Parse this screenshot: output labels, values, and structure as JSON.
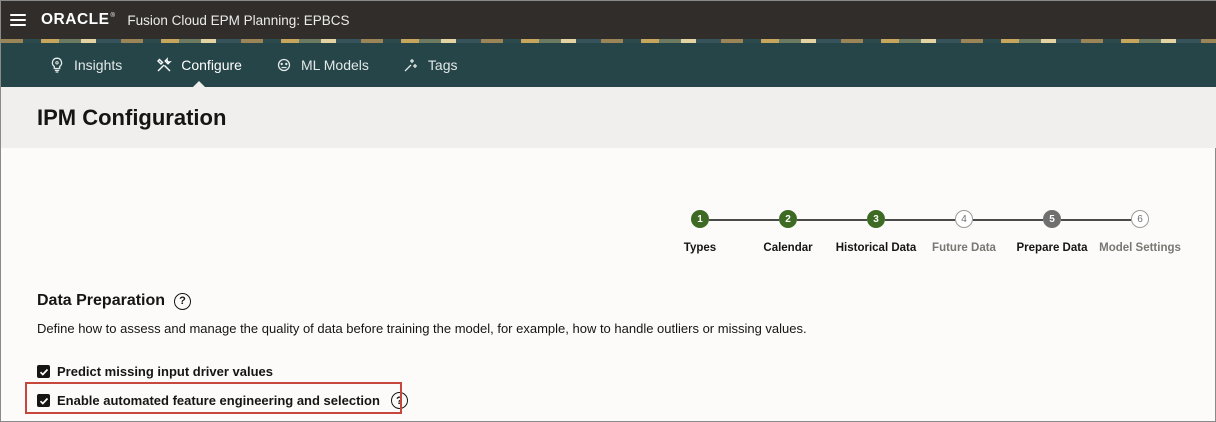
{
  "topbar": {
    "logo": "ORACLE",
    "app_title": "Fusion Cloud EPM Planning: EPBCS"
  },
  "nav": {
    "tabs": [
      {
        "label": "Insights",
        "icon": "lightbulb-icon"
      },
      {
        "label": "Configure",
        "icon": "tools-icon"
      },
      {
        "label": "ML Models",
        "icon": "ml-models-icon"
      },
      {
        "label": "Tags",
        "icon": "tags-icon"
      }
    ]
  },
  "page": {
    "title": "IPM Configuration"
  },
  "train": {
    "steps": [
      {
        "num": "1",
        "label": "Types",
        "state": "done"
      },
      {
        "num": "2",
        "label": "Calendar",
        "state": "done"
      },
      {
        "num": "3",
        "label": "Historical Data",
        "state": "done"
      },
      {
        "num": "4",
        "label": "Future Data",
        "state": "todo"
      },
      {
        "num": "5",
        "label": "Prepare Data",
        "state": "current"
      },
      {
        "num": "6",
        "label": "Model Settings",
        "state": "todo"
      }
    ]
  },
  "section": {
    "title": "Data Preparation",
    "description": "Define how to assess and manage the quality of data before training the model, for example, how to handle outliers or missing values.",
    "options": [
      {
        "label": "Predict missing input driver values",
        "checked": true
      },
      {
        "label": "Enable automated feature engineering and selection",
        "checked": true
      }
    ]
  },
  "colors": {
    "nav_bg": "#254548",
    "topbar_bg": "#312d2a",
    "step_done": "#3d6b24",
    "highlight": "#c7473d"
  }
}
